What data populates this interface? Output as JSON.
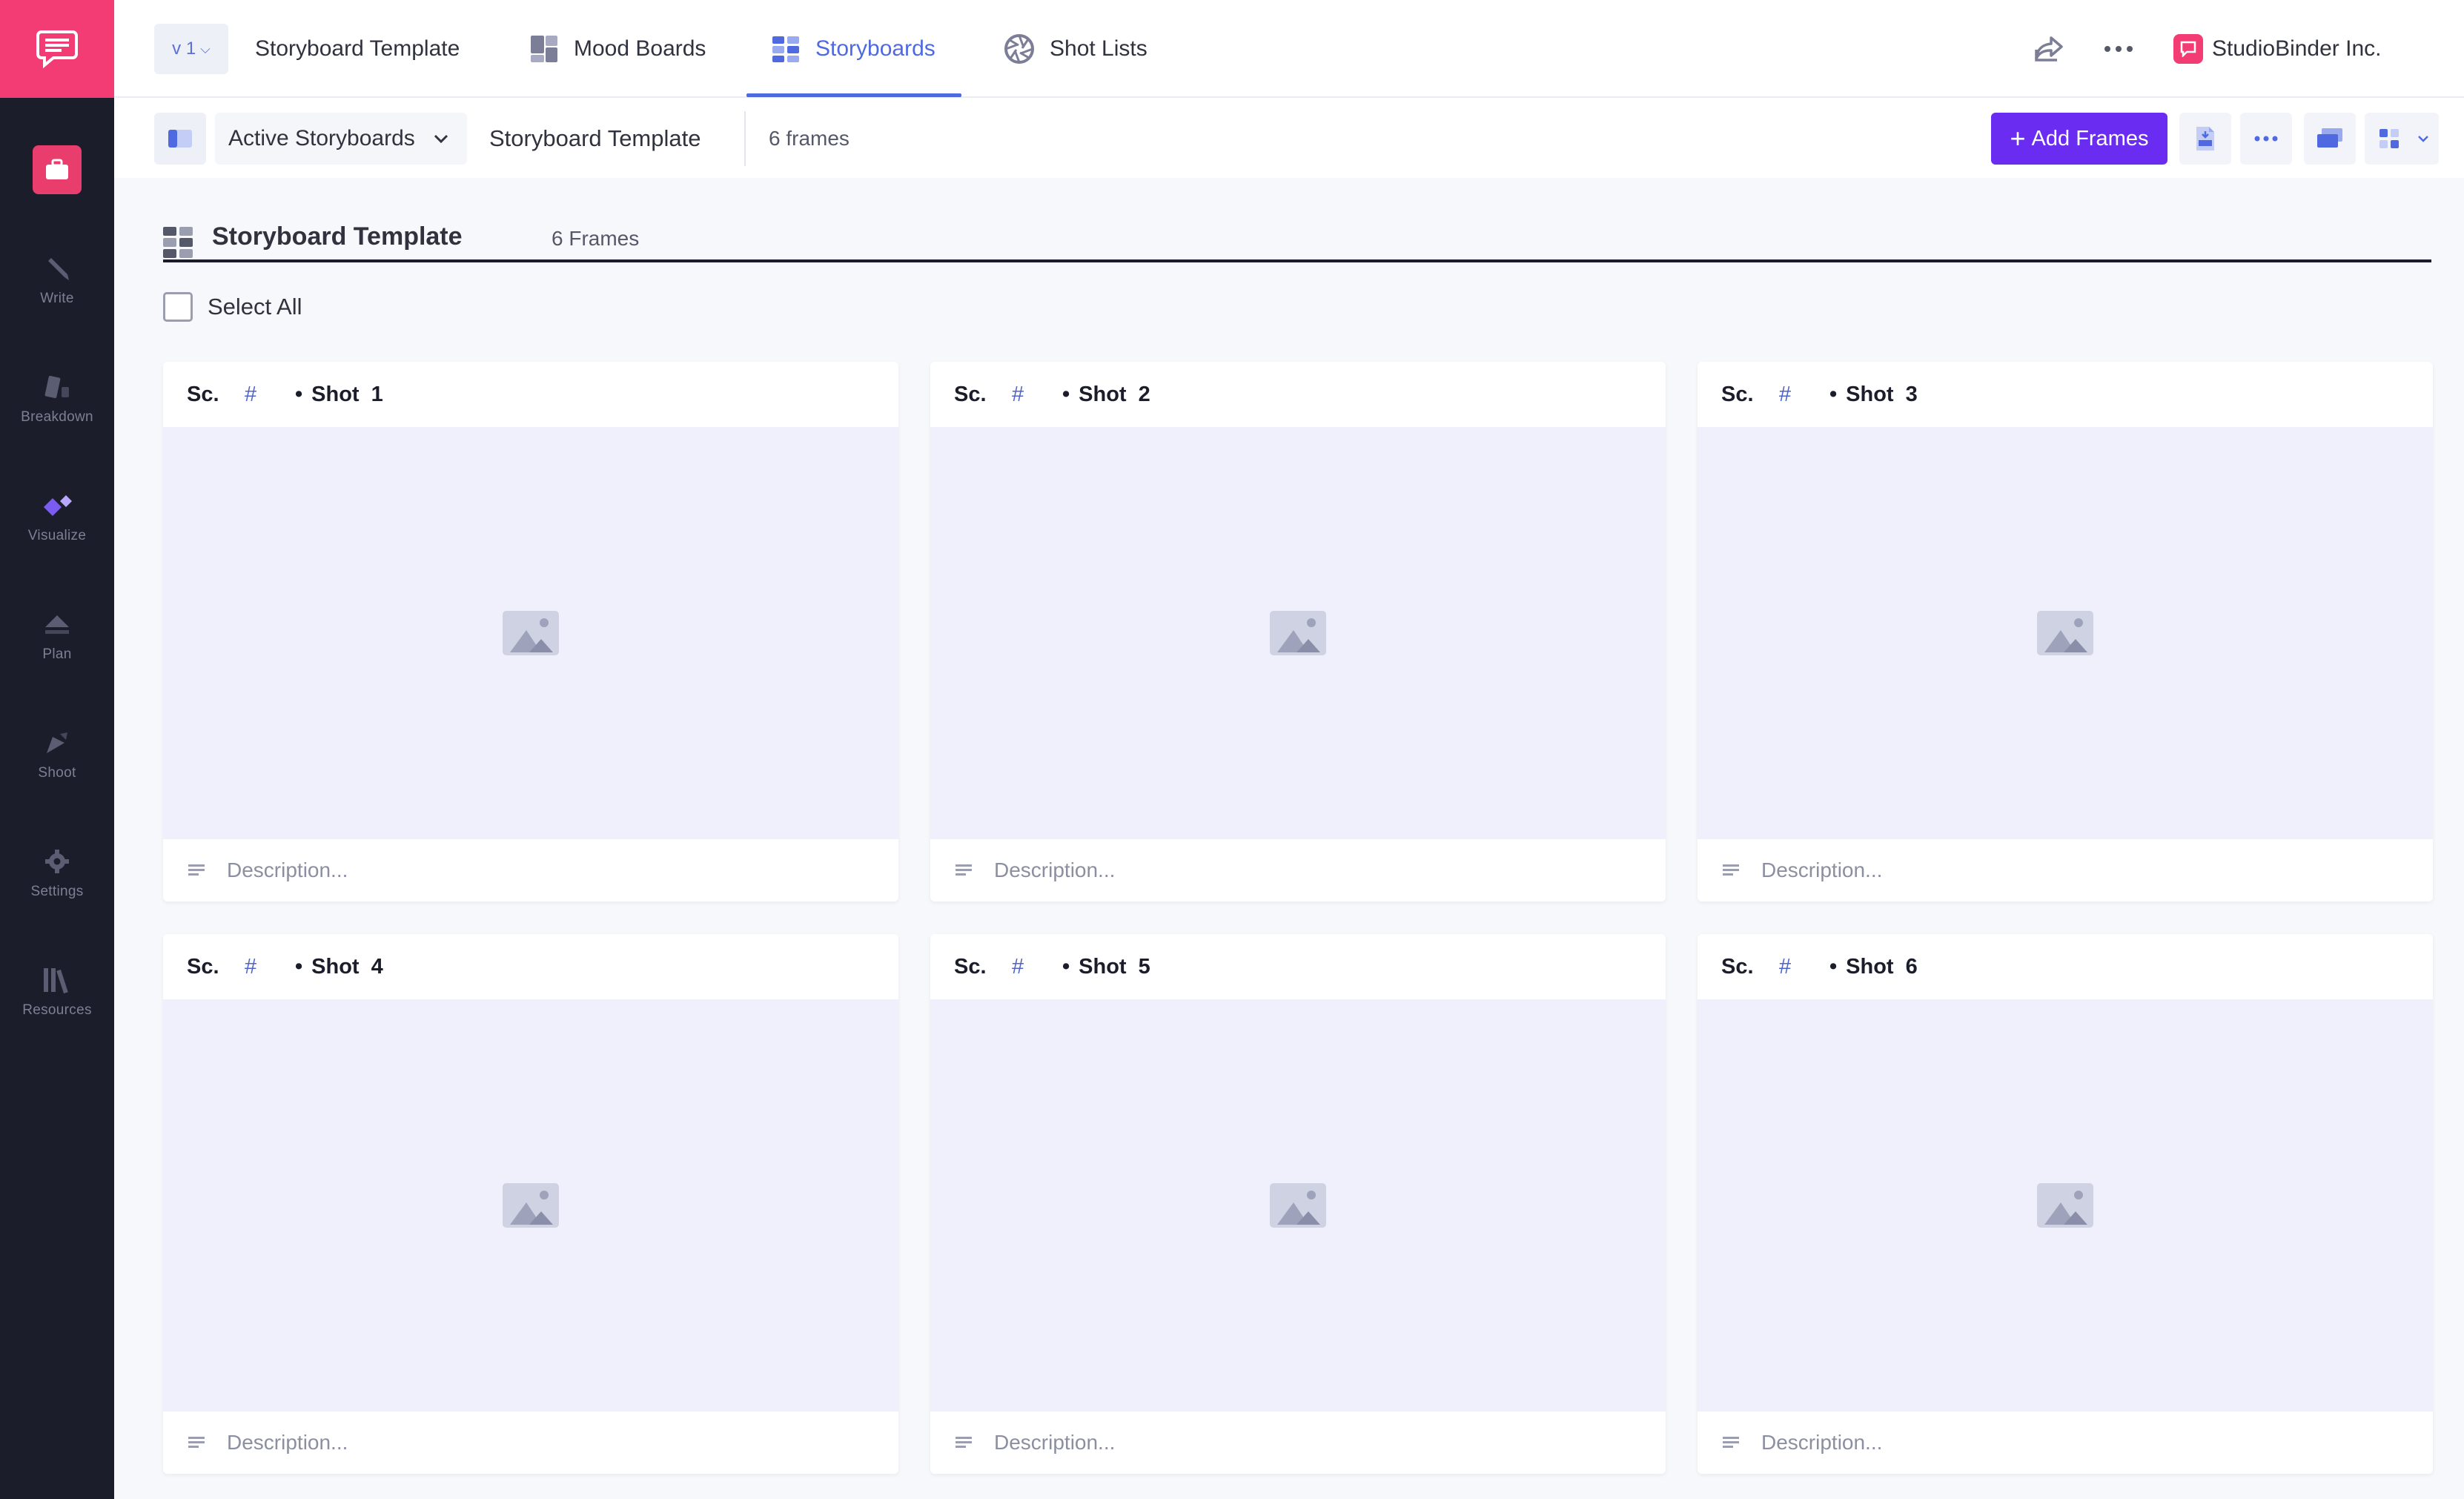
{
  "sidebar": {
    "items": [
      {
        "label": "Write",
        "icon": "pencil-icon"
      },
      {
        "label": "Breakdown",
        "icon": "breakdown-icon"
      },
      {
        "label": "Visualize",
        "icon": "visualize-icon"
      },
      {
        "label": "Plan",
        "icon": "plan-icon"
      },
      {
        "label": "Shoot",
        "icon": "shoot-icon"
      },
      {
        "label": "Settings",
        "icon": "gear-icon"
      },
      {
        "label": "Resources",
        "icon": "books-icon"
      }
    ]
  },
  "topbar": {
    "version": "v 1",
    "nav": [
      {
        "label": "Storyboard Template"
      },
      {
        "label": "Mood Boards"
      },
      {
        "label": "Storyboards"
      },
      {
        "label": "Shot Lists"
      }
    ],
    "company": "StudioBinder Inc."
  },
  "toolbar": {
    "select_value": "Active Storyboards",
    "title": "Storyboard Template",
    "count": "6 frames",
    "add_label": "Add Frames"
  },
  "section": {
    "title": "Storyboard Template",
    "count": "6 Frames",
    "select_all": "Select All"
  },
  "frames": [
    {
      "sc": "Sc.",
      "hash": "#",
      "shot": "Shot",
      "num": "1",
      "desc_placeholder": "Description..."
    },
    {
      "sc": "Sc.",
      "hash": "#",
      "shot": "Shot",
      "num": "2",
      "desc_placeholder": "Description..."
    },
    {
      "sc": "Sc.",
      "hash": "#",
      "shot": "Shot",
      "num": "3",
      "desc_placeholder": "Description..."
    },
    {
      "sc": "Sc.",
      "hash": "#",
      "shot": "Shot",
      "num": "4",
      "desc_placeholder": "Description..."
    },
    {
      "sc": "Sc.",
      "hash": "#",
      "shot": "Shot",
      "num": "5",
      "desc_placeholder": "Description..."
    },
    {
      "sc": "Sc.",
      "hash": "#",
      "shot": "Shot",
      "num": "6",
      "desc_placeholder": "Description..."
    }
  ],
  "colors": {
    "brand": "#f23c73",
    "accent": "#4f6ae0",
    "add_button": "#6a2cf0",
    "sidebar_bg": "#1c1d2b"
  }
}
